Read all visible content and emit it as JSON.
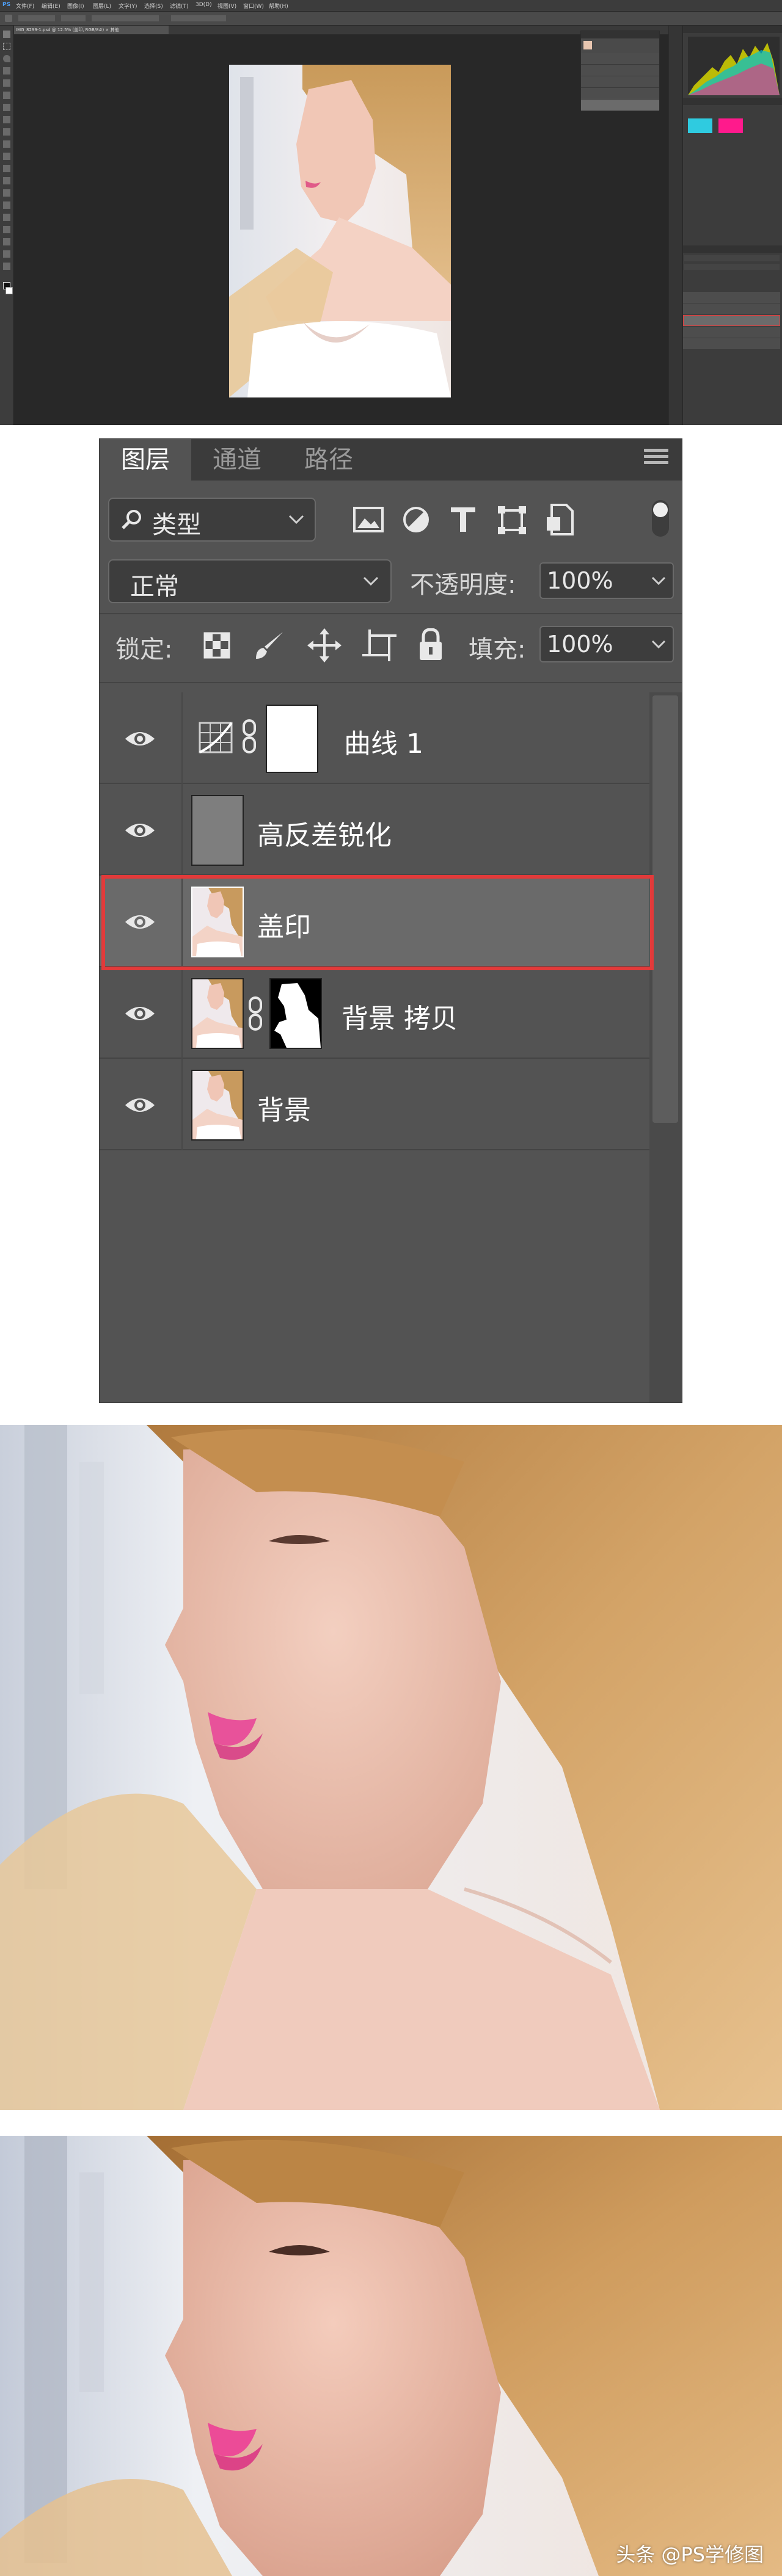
{
  "photoshop": {
    "menu": [
      "PS",
      "文件(F)",
      "编辑(E)",
      "图像(I)",
      "图层(L)",
      "文字(Y)",
      "选择(S)",
      "滤镜(T)",
      "3D(D)",
      "视图(V)",
      "窗口(W)",
      "帮助(H)"
    ],
    "document_tab": "IMG_8299-1.psd @ 12.5% (盖印, RGB/8#) × 其他"
  },
  "layers_panel": {
    "tabs": [
      "图层",
      "通道",
      "路径"
    ],
    "filter_label": "类型",
    "blend_mode": "正常",
    "opacity_label": "不透明度:",
    "opacity_value": "100%",
    "lock_label": "锁定:",
    "fill_label": "填充:",
    "fill_value": "100%",
    "layers": [
      {
        "name": "曲线 1",
        "kind": "adjustment-curves",
        "visible": true,
        "selected": false
      },
      {
        "name": "高反差锐化",
        "kind": "gray-layer",
        "visible": true,
        "selected": false
      },
      {
        "name": "盖印",
        "kind": "photo",
        "visible": true,
        "selected": true
      },
      {
        "name": "背景 拷贝",
        "kind": "photo-with-mask",
        "visible": true,
        "selected": false
      },
      {
        "name": "背景",
        "kind": "photo",
        "visible": true,
        "selected": false
      }
    ],
    "colors": {
      "panel": "#535353",
      "selected_row": "#6a6a6a",
      "highlight_border": "#e23a3a"
    }
  },
  "watermark": "头条 @PS学修图"
}
